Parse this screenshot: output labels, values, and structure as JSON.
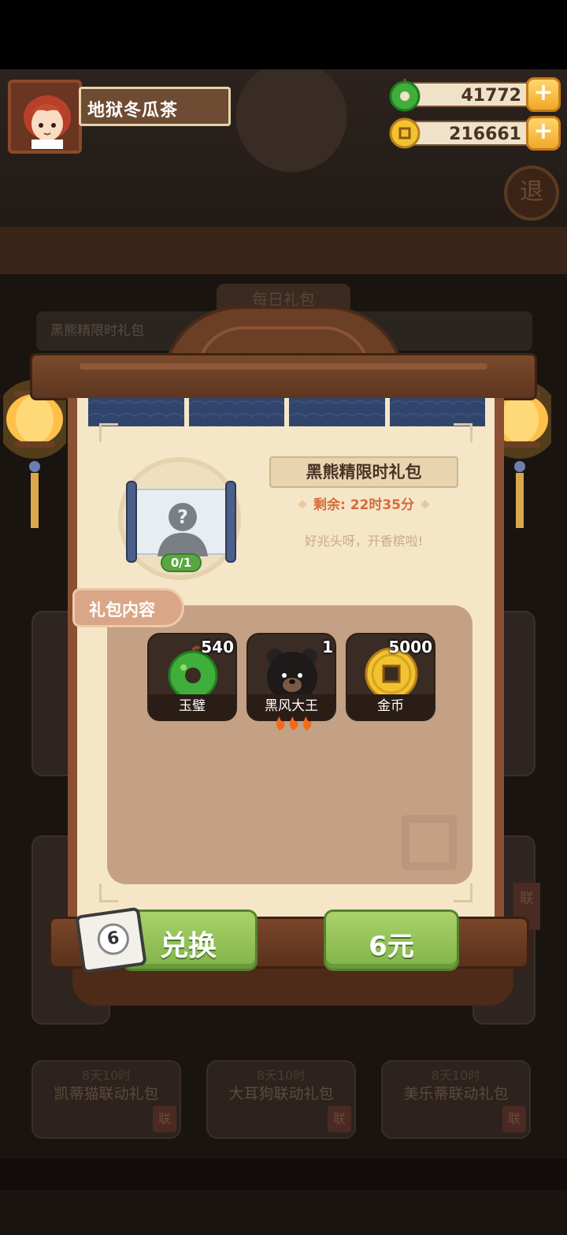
{
  "player": {
    "name": "地狱冬瓜茶"
  },
  "currencies": [
    {
      "id": "jade",
      "icon": "jade-disc-icon",
      "value": "41772"
    },
    {
      "id": "gold",
      "icon": "gold-coin-icon",
      "value": "216661"
    }
  ],
  "plus_label": "+",
  "background": {
    "sign": "每日礼包",
    "bar_title": "黑熊精限时礼包",
    "exit_label": "退",
    "side_tag": "联",
    "bottom_cards": [
      {
        "tag": "8天10时",
        "label": "凯蒂猫联动礼包",
        "lian": "联"
      },
      {
        "tag": "8天10时",
        "label": "大耳狗联动礼包",
        "lian": "联"
      },
      {
        "tag": "8天10时",
        "label": "美乐蒂联动礼包",
        "lian": "联"
      }
    ]
  },
  "pack": {
    "title": "黑熊精限时礼包",
    "remain_label": "剩余: 22时35分",
    "slogan": "好兆头呀，开香槟啦!",
    "progress": "0/1",
    "section_title": "礼包内容",
    "items": [
      {
        "name": "玉璧",
        "count": "540",
        "icon": "jade-disc-icon"
      },
      {
        "name": "黑风大王",
        "count": "1",
        "icon": "black-bear-icon"
      },
      {
        "name": "金币",
        "count": "5000",
        "icon": "gold-coin-icon"
      }
    ]
  },
  "buttons": {
    "ticket_number": "6",
    "exchange_label": "兑换",
    "price_label": "6元"
  },
  "colors": {
    "button_green": "#80b448",
    "accent_orange": "#d76b3a",
    "frame_brown": "#6b3f25",
    "paper": "#f5e6c8"
  }
}
